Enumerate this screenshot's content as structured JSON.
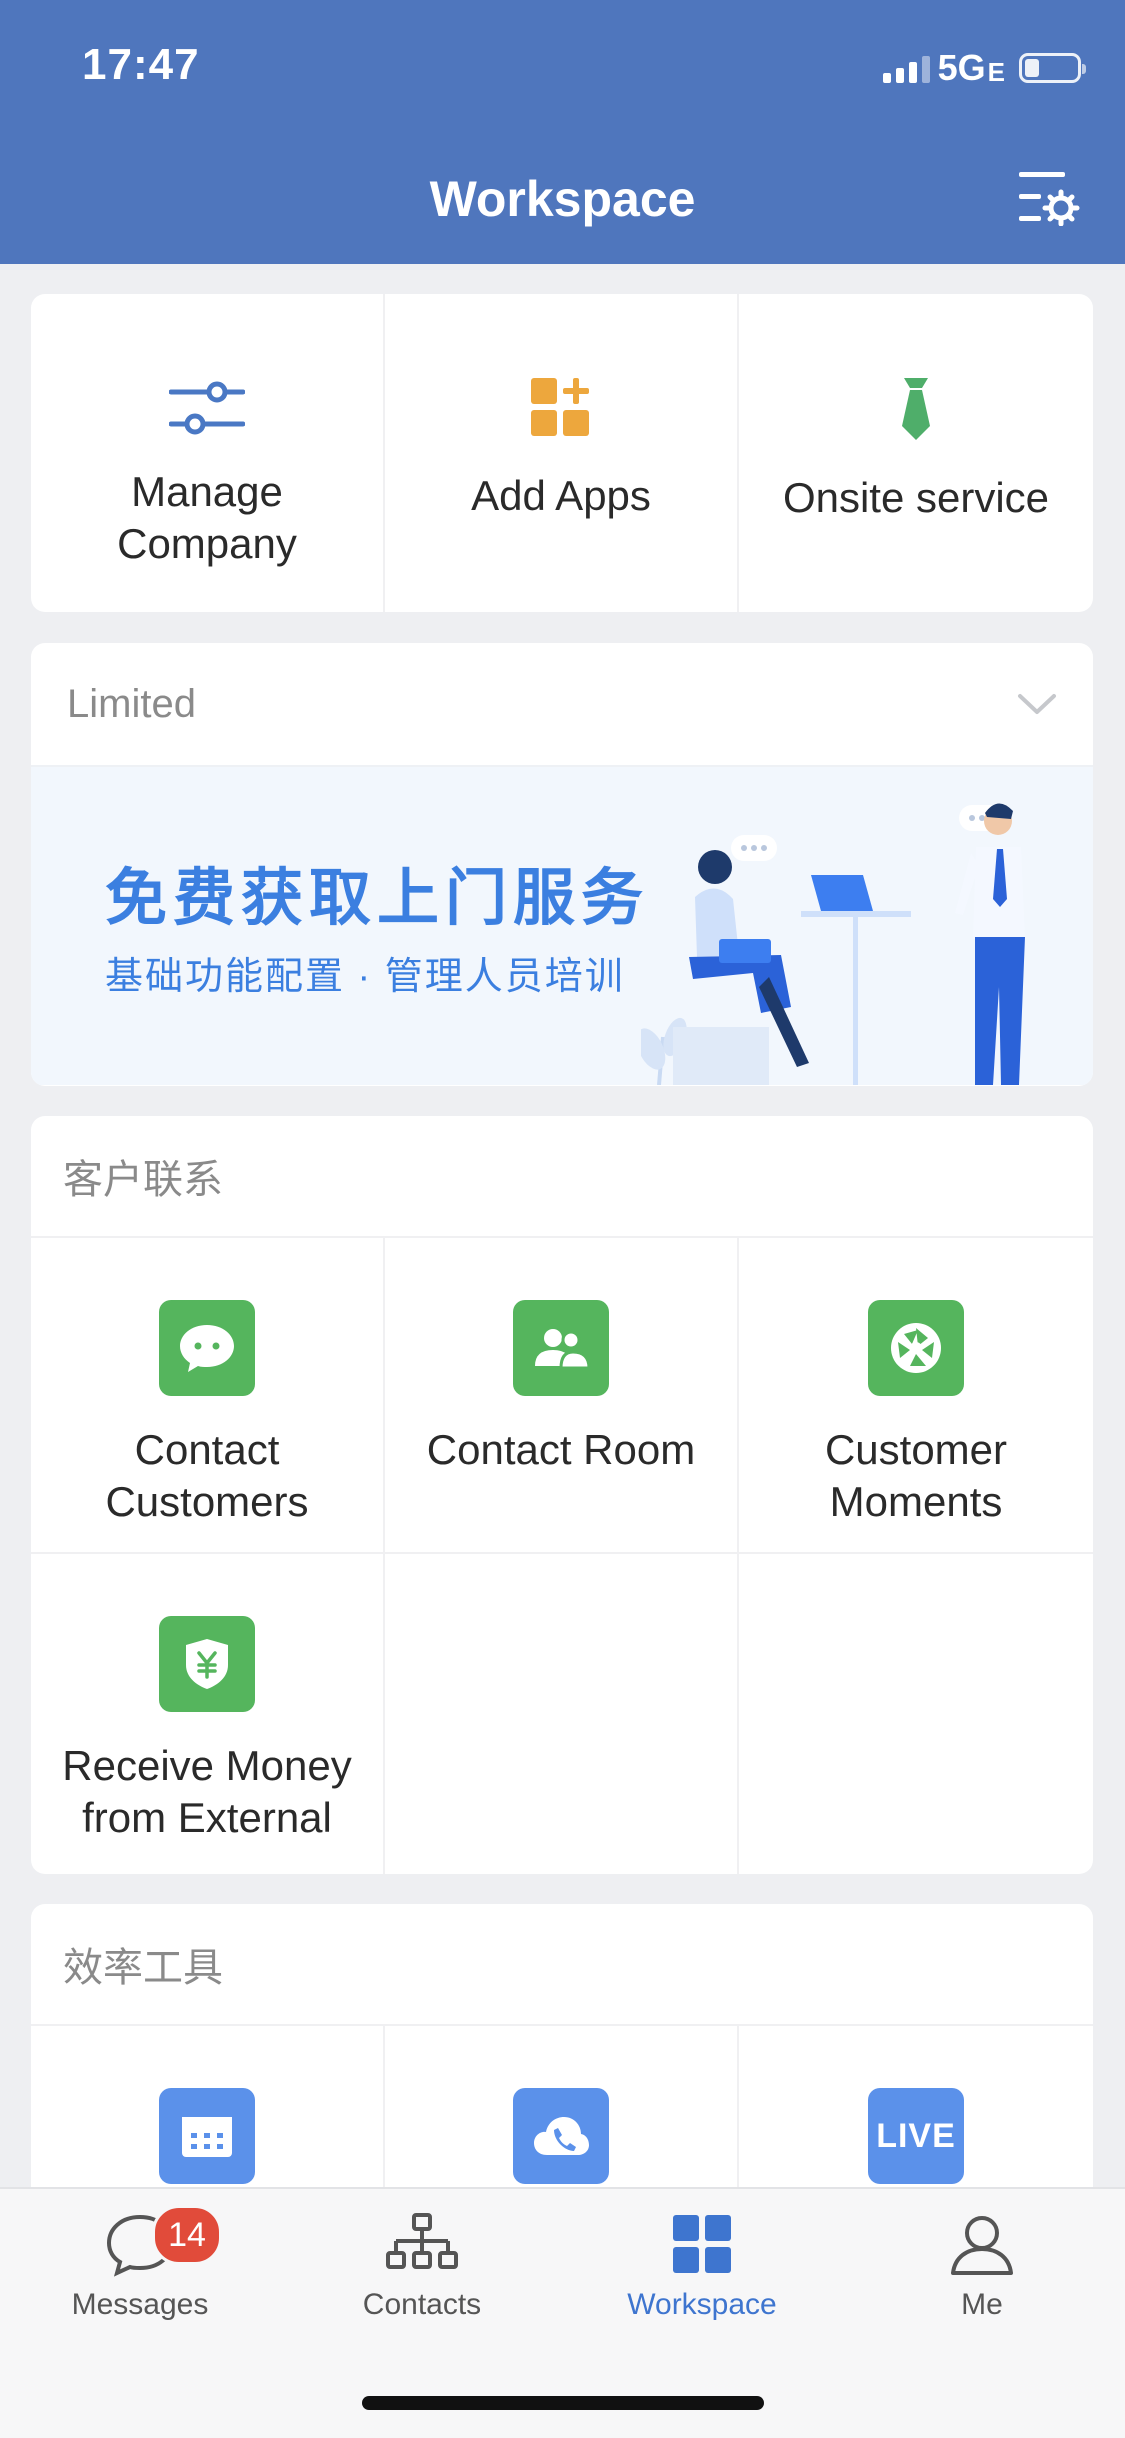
{
  "status_bar": {
    "time": "17:47",
    "network": "5G",
    "network_suffix": "E"
  },
  "header": {
    "title": "Workspace"
  },
  "top_actions": [
    {
      "label": "Manage\nCompany",
      "icon": "sliders-icon"
    },
    {
      "label": "Add Apps",
      "icon": "add-apps-icon"
    },
    {
      "label": "Onsite service",
      "icon": "tie-icon"
    }
  ],
  "limited": {
    "label": "Limited",
    "banner_title": "免费获取上门服务",
    "banner_subtitle": "基础功能配置 · 管理人员培训"
  },
  "customer_section": {
    "title": "客户联系",
    "items": [
      {
        "label": "Contact\nCustomers",
        "icon": "chat-bubble-icon"
      },
      {
        "label": "Contact Room",
        "icon": "group-icon"
      },
      {
        "label": "Customer\nMoments",
        "icon": "shutter-icon"
      },
      {
        "label": "Receive Money\nfrom External",
        "icon": "yuan-shield-icon"
      }
    ]
  },
  "efficiency_section": {
    "title": "效率工具",
    "items": [
      {
        "icon": "calendar-icon"
      },
      {
        "icon": "cloud-phone-icon"
      },
      {
        "icon": "live-icon",
        "text": "LIVE"
      }
    ]
  },
  "tabbar": {
    "tabs": [
      {
        "label": "Messages",
        "badge": "14"
      },
      {
        "label": "Contacts"
      },
      {
        "label": "Workspace",
        "active": true
      },
      {
        "label": "Me"
      }
    ]
  },
  "colors": {
    "header_bg": "#4f76bd",
    "accent": "#3e75cf",
    "green_tile": "#55b55d",
    "blue_tile": "#5b91ea",
    "badge": "#e14b3a"
  }
}
